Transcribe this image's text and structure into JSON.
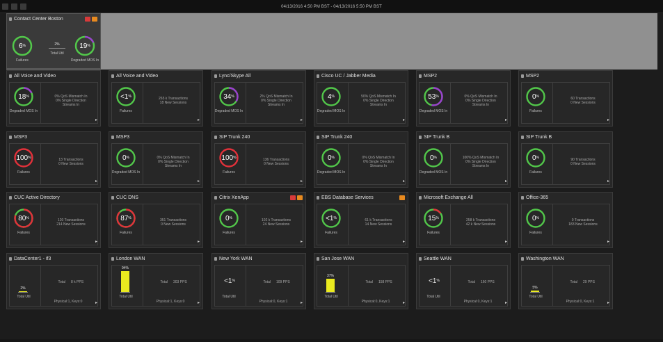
{
  "header": {
    "date_range": "04/13/2016 4:50 PM BST - 04/13/2016 5:50 PM BST"
  },
  "featured": {
    "title": "Contact Center Boston",
    "badges": [
      "red",
      "orange"
    ],
    "left_gauge": {
      "value": "6",
      "label": "Failures",
      "color": "#52c74a",
      "fraction": 0.06
    },
    "middle": {
      "pct": "2%",
      "label": "Total Util"
    },
    "right_gauge": {
      "value": "19",
      "label": "Degraded MOS In",
      "color": "#52c74a",
      "accent": "#9b3fd0",
      "fraction": 0.19
    }
  },
  "tiles": [
    {
      "title": "All Voice and Video",
      "kind": "gauge",
      "value": "18",
      "color": "#52c74a",
      "accent": "#9b3fd0",
      "fraction": 0.18,
      "label": "Degraded MOS In",
      "desc": [
        "0% QoS Mismatch In",
        "0% Single Direction",
        "Streams In"
      ],
      "badges": []
    },
    {
      "title": "All Voice and Video",
      "kind": "gauge",
      "value": "<1",
      "color": "#52c74a",
      "accent": "",
      "fraction": 0,
      "label": "Failures",
      "desc": [
        "265 k Transactions",
        "18 New Sessions"
      ],
      "badges": []
    },
    {
      "title": "Lync/Skype All",
      "kind": "gauge",
      "value": "34",
      "color": "#52c74a",
      "accent": "#9b3fd0",
      "fraction": 0.34,
      "label": "Degraded MOS In",
      "desc": [
        "2% QoS Mismatch In",
        "0% Single Direction",
        "Streams In"
      ],
      "badges": []
    },
    {
      "title": "Cisco UC / Jabber Media",
      "kind": "gauge",
      "value": "4",
      "color": "#52c74a",
      "accent": "",
      "fraction": 0.04,
      "label": "Degraded MOS In",
      "desc": [
        "50% QoS Mismatch In",
        "0% Single Direction",
        "Streams In"
      ],
      "badges": []
    },
    {
      "title": "MSP2",
      "kind": "gauge",
      "value": "53",
      "color": "#52c74a",
      "accent": "#9b3fd0",
      "fraction": 0.53,
      "label": "Degraded MOS In",
      "desc": [
        "0% QoS Mismatch In",
        "0% Single Direction",
        "Streams In"
      ],
      "badges": []
    },
    {
      "title": "MSP2",
      "kind": "gauge",
      "value": "0",
      "color": "#52c74a",
      "accent": "",
      "fraction": 0,
      "label": "Failures",
      "desc": [
        "60 Transactions",
        "0 New Sessions"
      ],
      "badges": []
    },
    {
      "title": "MSP3",
      "kind": "gauge",
      "value": "100",
      "color": "#e3313a",
      "accent": "",
      "fraction": 1,
      "label": "Failures",
      "desc": [
        "13 Transactions",
        "0 New Sessions"
      ],
      "badges": []
    },
    {
      "title": "MSP3",
      "kind": "gauge",
      "value": "0",
      "color": "#52c74a",
      "accent": "",
      "fraction": 0,
      "label": "Degraded MOS In",
      "desc": [
        "0% QoS Mismatch In",
        "0% Single Direction",
        "Streams In"
      ],
      "badges": []
    },
    {
      "title": "SIP Trunk 240",
      "kind": "gauge",
      "value": "100",
      "color": "#e3313a",
      "accent": "",
      "fraction": 1,
      "label": "Failures",
      "desc": [
        "136 Transactions",
        "0 New Sessions"
      ],
      "badges": []
    },
    {
      "title": "SIP Trunk 240",
      "kind": "gauge",
      "value": "0",
      "color": "#52c74a",
      "accent": "",
      "fraction": 0,
      "label": "Degraded MOS In",
      "desc": [
        "0% QoS Mismatch In",
        "0% Single Direction",
        "Streams In"
      ],
      "badges": []
    },
    {
      "title": "SIP Trunk B",
      "kind": "gauge",
      "value": "0",
      "color": "#52c74a",
      "accent": "",
      "fraction": 0,
      "label": "Degraded MOS In",
      "desc": [
        "100% QoS Mismatch In",
        "0% Single Direction",
        "Streams In"
      ],
      "badges": []
    },
    {
      "title": "SIP Trunk B",
      "kind": "gauge",
      "value": "0",
      "color": "#52c74a",
      "accent": "",
      "fraction": 0,
      "label": "Failures",
      "desc": [
        "90 Transactions",
        "0 New Sessions"
      ],
      "badges": []
    },
    {
      "title": "CUC Active Directory",
      "kind": "gauge",
      "value": "80",
      "color": "#52c74a",
      "accent": "#e3313a",
      "fraction": 0.8,
      "label": "Failures",
      "desc": [
        "120 Transactions",
        "214 New Sessions"
      ],
      "badges": []
    },
    {
      "title": "CUC DNS",
      "kind": "gauge",
      "value": "87",
      "color": "#52c74a",
      "accent": "#e3313a",
      "fraction": 0.87,
      "label": "Failures",
      "desc": [
        "351 Transactions",
        "0 New Sessions"
      ],
      "badges": []
    },
    {
      "title": "Citrix XenApp",
      "kind": "gauge",
      "value": "0",
      "color": "#52c74a",
      "accent": "",
      "fraction": 0,
      "label": "Failures",
      "desc": [
        "102 k Transactions",
        "24 New Sessions"
      ],
      "badges": [
        "red",
        "orange"
      ]
    },
    {
      "title": "EBS Database Services",
      "kind": "gauge",
      "value": "<1",
      "color": "#52c74a",
      "accent": "",
      "fraction": 0,
      "label": "Failures",
      "desc": [
        "61 k Transactions",
        "14 New Sessions"
      ],
      "badges": [
        "orange"
      ]
    },
    {
      "title": "Microsoft Exchange All",
      "kind": "gauge",
      "value": "15",
      "color": "#52c74a",
      "accent": "#e3313a",
      "fraction": 0.15,
      "label": "Failures",
      "desc": [
        "258 k Transactions",
        "42 k New Sessions"
      ],
      "badges": []
    },
    {
      "title": "Office-365",
      "kind": "gauge",
      "value": "0",
      "color": "#52c74a",
      "accent": "",
      "fraction": 0,
      "label": "Failures",
      "desc": [
        "0 Transactions",
        "183 New Sessions"
      ],
      "badges": []
    },
    {
      "title": "DataCenter1 - if3",
      "kind": "wan",
      "mode": "bar",
      "pct": "2%",
      "fill": 0.03,
      "label": "Total Util",
      "total_label": "Total",
      "total_value": "8 k PPS",
      "phys": "Physical:1, Keys:0"
    },
    {
      "title": "London WAN",
      "kind": "wan",
      "mode": "bar",
      "pct": "94%",
      "fill": 0.94,
      "label": "Total Util",
      "total_label": "Total",
      "total_value": "303 PPS",
      "phys": "Physical:1, Keys:0"
    },
    {
      "title": "New York WAN",
      "kind": "wan",
      "mode": "less",
      "pct": "<1",
      "fill": 0,
      "label": "Total Util",
      "total_label": "Total",
      "total_value": "109 PPS",
      "phys": "Physical:0, Keys:1"
    },
    {
      "title": "San Jose WAN",
      "kind": "wan",
      "mode": "bar",
      "pct": "37%",
      "fill": 0.6,
      "label": "Total Util",
      "total_label": "Total",
      "total_value": "158 PPS",
      "phys": "Physical:0, Keys:1"
    },
    {
      "title": "Seattle WAN",
      "kind": "wan",
      "mode": "less",
      "pct": "<1",
      "fill": 0,
      "label": "Total Util",
      "total_label": "Total",
      "total_value": "160 PPS",
      "phys": "Physical:0, Keys:1"
    },
    {
      "title": "Washington WAN",
      "kind": "wan",
      "mode": "bar",
      "pct": "5%",
      "fill": 0.05,
      "label": "Total Util",
      "total_label": "Total",
      "total_value": "29 PPS",
      "phys": "Physical:0, Keys:1"
    }
  ],
  "arrow_glyph": "▸"
}
